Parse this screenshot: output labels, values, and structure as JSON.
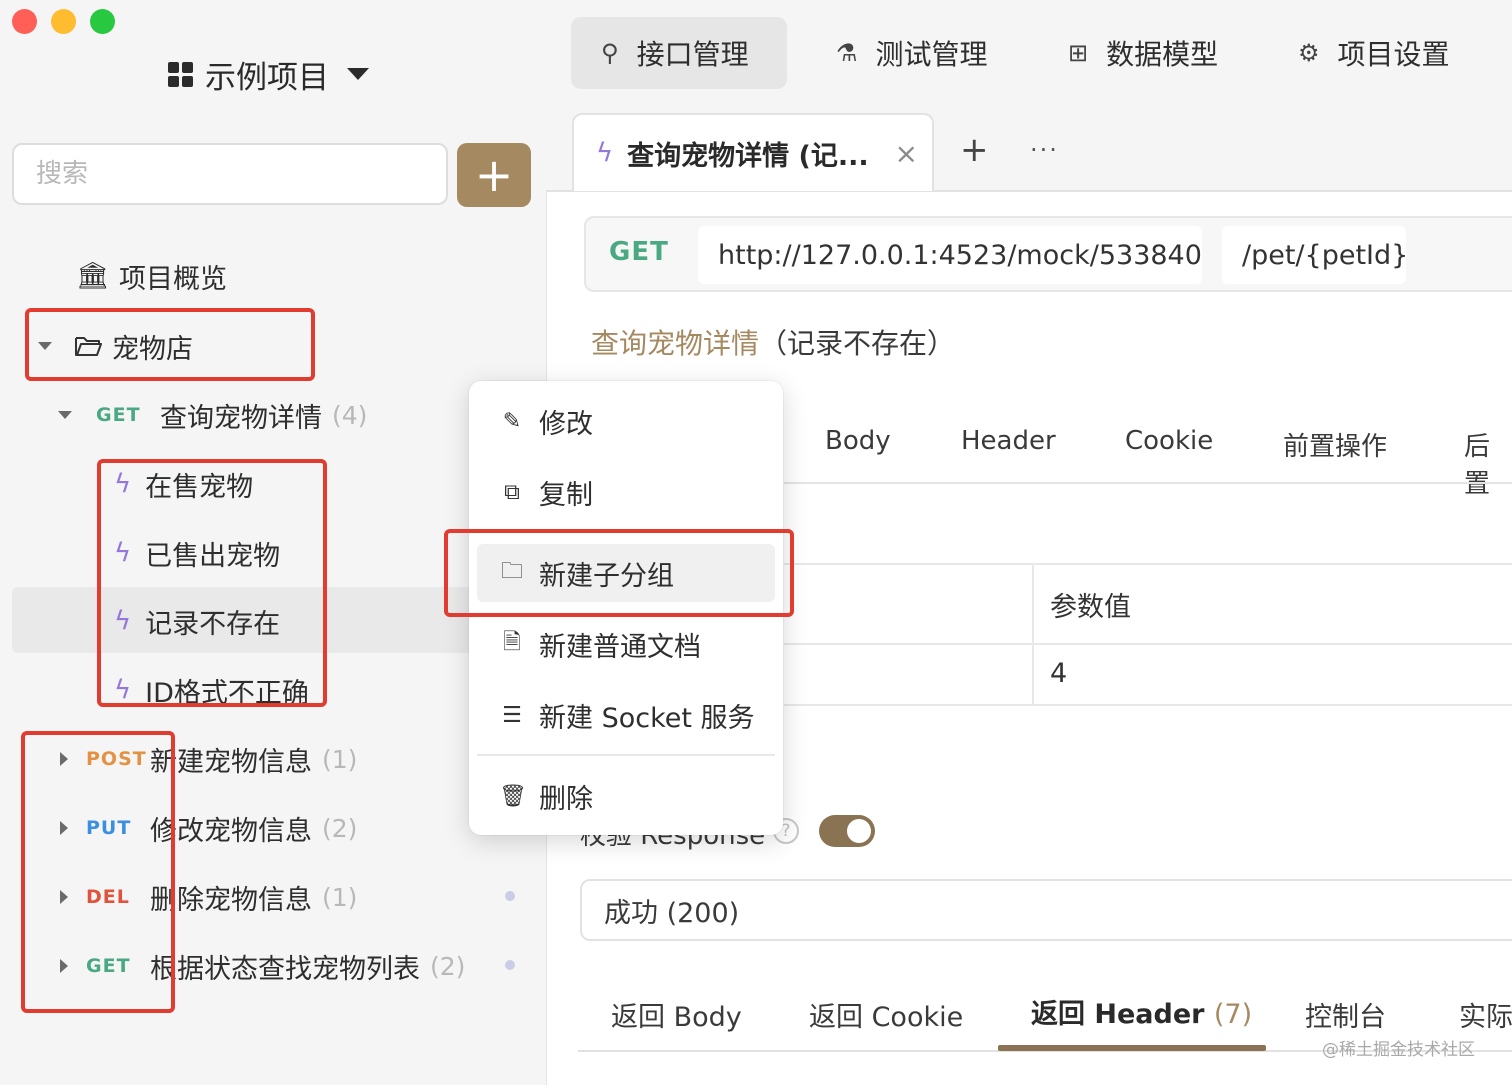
{
  "window": {
    "traffic_lights": [
      "#ff5f57",
      "#febc2e",
      "#28c840"
    ]
  },
  "sidebar": {
    "project_name": "示例项目",
    "search_placeholder": "搜索",
    "add_label": "+",
    "overview_label": "项目概览",
    "folder_label": "宠物店",
    "endpoints": [
      {
        "method": "GET",
        "name": "查询宠物详情",
        "count": "(4)"
      },
      {
        "method": "POST",
        "name": "新建宠物信息",
        "count": "(1)"
      },
      {
        "method": "PUT",
        "name": "修改宠物信息",
        "count": "(2)"
      },
      {
        "method": "DEL",
        "name": "删除宠物信息",
        "count": "(1)"
      },
      {
        "method": "GET",
        "name": "根据状态查找宠物列表",
        "count": "(2)"
      }
    ],
    "cases": [
      "在售宠物",
      "已售出宠物",
      "记录不存在",
      "ID格式不正确"
    ]
  },
  "topnav": {
    "items": [
      {
        "label": "接口管理",
        "icon": "api-icon"
      },
      {
        "label": "测试管理",
        "icon": "flask-icon"
      },
      {
        "label": "数据模型",
        "icon": "model-icon"
      },
      {
        "label": "项目设置",
        "icon": "gear-icon"
      }
    ]
  },
  "tab": {
    "title": "查询宠物详情 (记...",
    "close": "×",
    "add": "+",
    "more": "···"
  },
  "request": {
    "method": "GET",
    "base_url": "http://127.0.0.1:4523/mock/533840",
    "path": "/pet/{petId}"
  },
  "breadcrumb": {
    "api": "查询宠物详情",
    "case": "（记录不存在）"
  },
  "param_tabs": [
    "Body",
    "Header",
    "Cookie",
    "前置操作",
    "后置"
  ],
  "params_table": {
    "header_value": "参数值",
    "value": "4"
  },
  "response_check": {
    "label": "校验 Response",
    "help": "?",
    "enabled": true
  },
  "response_select": "成功 (200)",
  "bottom_tabs": {
    "body": "返回 Body",
    "cookie": "返回 Cookie",
    "header": "返回 Header",
    "header_count": "(7)",
    "console": "控制台",
    "actual": "实际"
  },
  "context_menu": {
    "items": [
      {
        "label": "修改",
        "icon": "pencil-icon"
      },
      {
        "label": "复制",
        "icon": "copy-icon"
      },
      {
        "label": "新建子分组",
        "icon": "folder-icon"
      },
      {
        "label": "新建普通文档",
        "icon": "document-icon"
      },
      {
        "label": "新建 Socket 服务",
        "icon": "server-icon"
      },
      {
        "label": "删除",
        "icon": "trash-icon"
      }
    ]
  },
  "watermark": "@稀土掘金技术社区",
  "colors": {
    "accent": "#a58961",
    "get": "#4aa882",
    "post": "#e39243",
    "put": "#3b8fe0",
    "delete": "#e0533c",
    "highlight_box": "#e23b2f"
  }
}
